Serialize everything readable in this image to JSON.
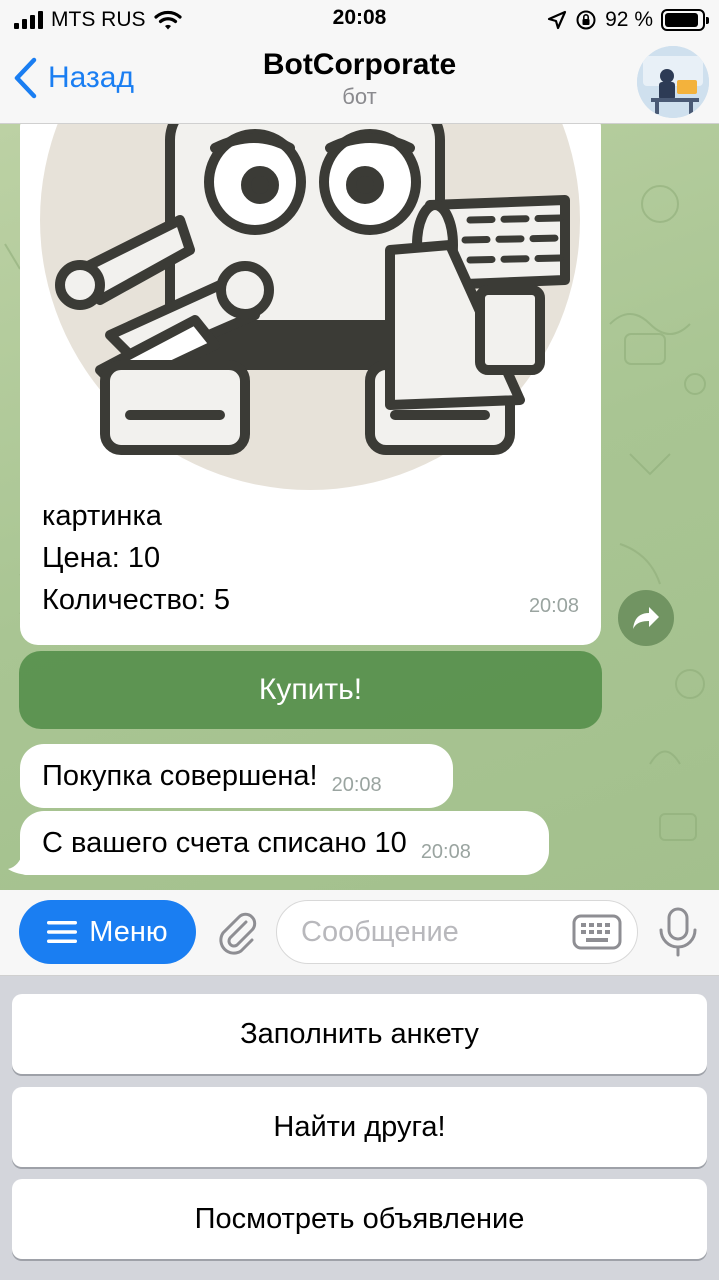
{
  "status": {
    "carrier": "MTS RUS",
    "time": "20:08",
    "battery_text": "92 %",
    "battery_level": 0.92
  },
  "header": {
    "back_label": "Назад",
    "title": "BotCorporate",
    "subtitle": "бот"
  },
  "chat": {
    "card": {
      "lines": [
        "картинка",
        "Цена: 10",
        "Количество: 5"
      ],
      "time": "20:08"
    },
    "buy_button_label": "Купить!",
    "messages": [
      {
        "text": "Покупка совершена!",
        "time": "20:08"
      },
      {
        "text": "С вашего счета списано 10",
        "time": "20:08"
      }
    ]
  },
  "input_bar": {
    "menu_label": "Меню",
    "placeholder": "Сообщение"
  },
  "keyboard": {
    "buttons": [
      {
        "label": "Заполнить анкету"
      },
      {
        "label": "Найти друга!"
      },
      {
        "label": "Посмотреть объявление"
      }
    ]
  },
  "colors": {
    "accent": "#1a7ef2",
    "chat_bg": "#a9c593",
    "inline_button": "#5a9a52"
  }
}
